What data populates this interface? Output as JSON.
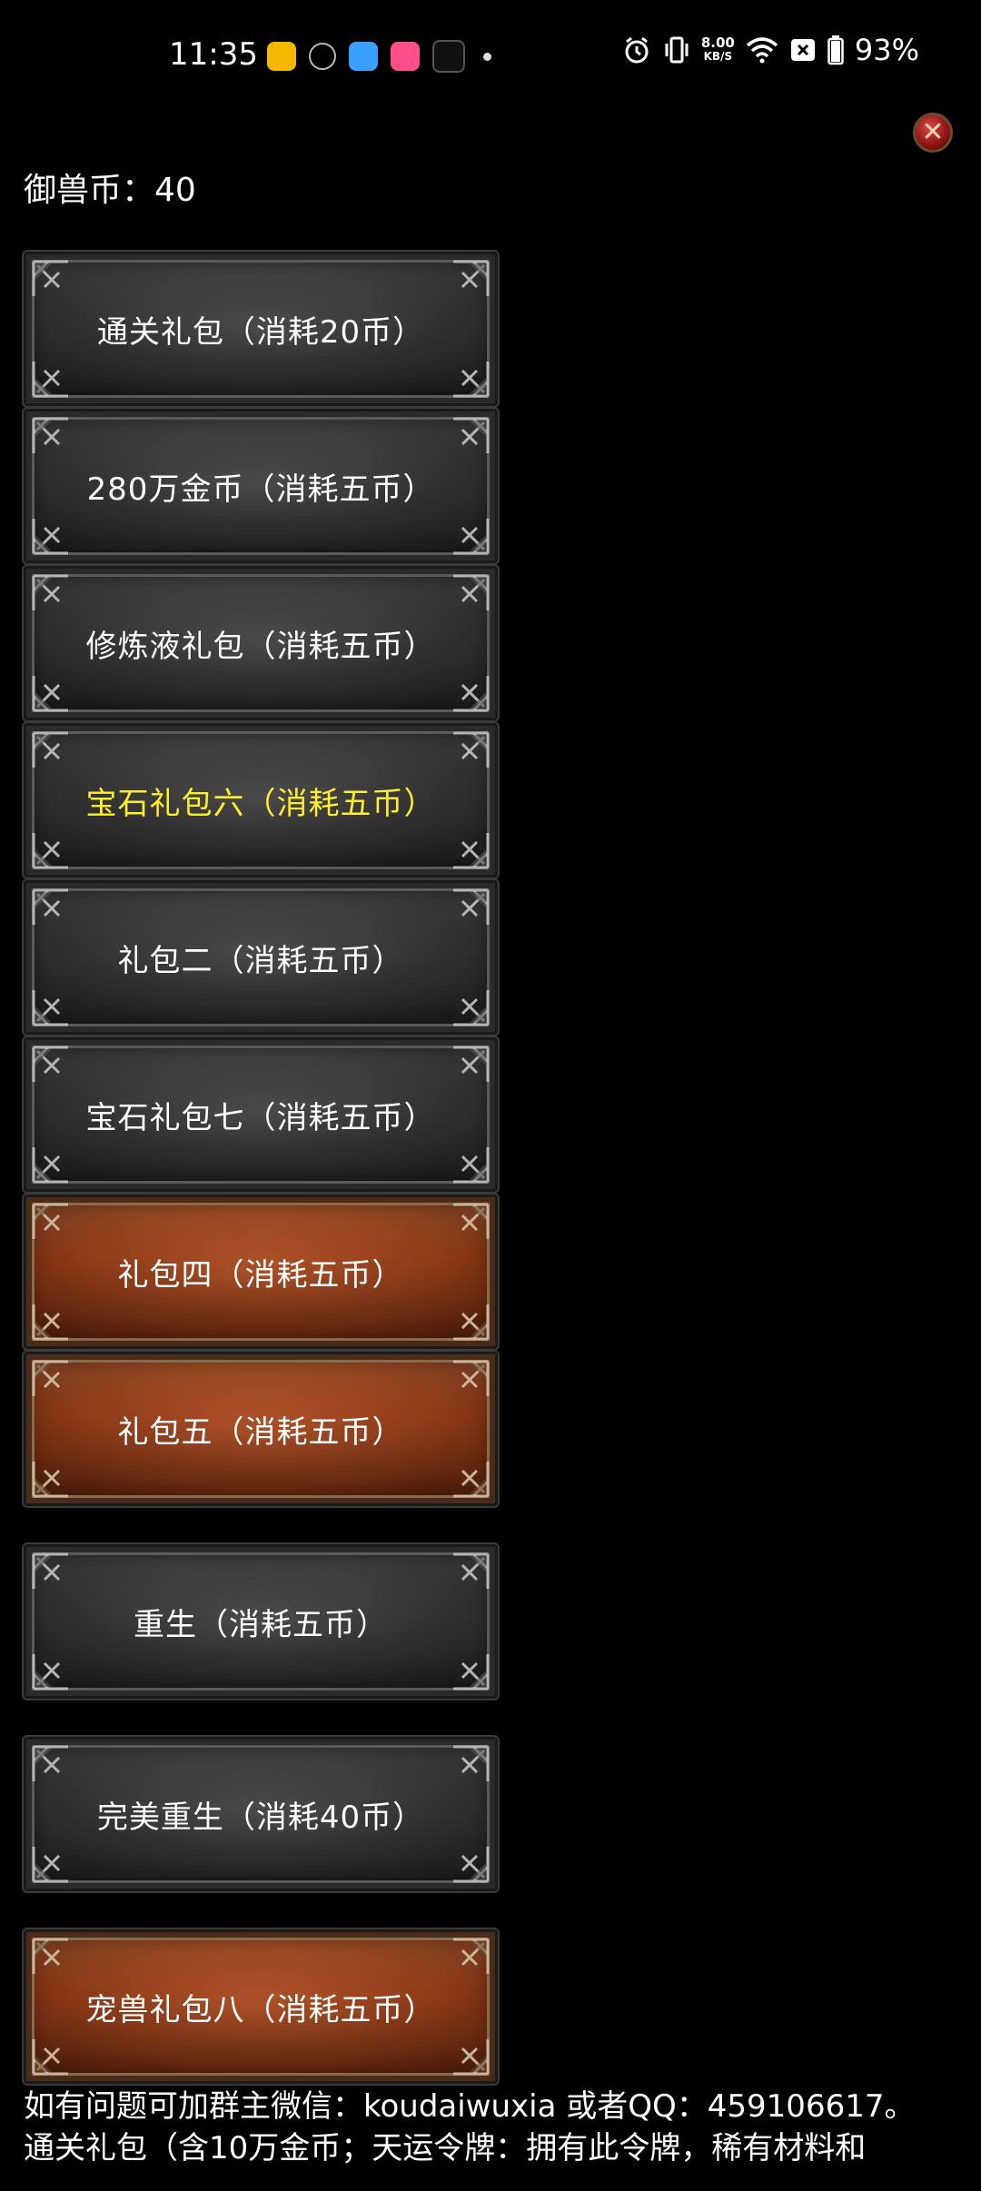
{
  "status_bar": {
    "time": "11:35",
    "net_speed_value": "8.00",
    "net_speed_unit": "KB/S",
    "battery_percent": "93%",
    "icons": [
      "alarm-icon",
      "vibrate-icon",
      "wifi-icon",
      "sim-off-icon",
      "battery-icon"
    ],
    "app_icons": [
      "app-yellow-icon",
      "app-swirl-icon",
      "app-blue-icon",
      "app-pink-icon",
      "tiktok-icon"
    ]
  },
  "header": {
    "currency_label": "御兽币：",
    "currency_value": "40"
  },
  "buttons": [
    {
      "label": "通关礼包（消耗20币）",
      "style": "gray",
      "text_color": "#ffffff"
    },
    {
      "label": "280万金币（消耗五币）",
      "style": "gray",
      "text_color": "#ffffff"
    },
    {
      "label": "修炼液礼包（消耗五币）",
      "style": "gray",
      "text_color": "#ffffff"
    },
    {
      "label": "宝石礼包六（消耗五币）",
      "style": "gray",
      "text_color": "#ffee2a"
    },
    {
      "label": "礼包二（消耗五币）",
      "style": "gray",
      "text_color": "#ffffff"
    },
    {
      "label": "宝石礼包七（消耗五币）",
      "style": "gray",
      "text_color": "#ffffff"
    },
    {
      "label": "礼包四（消耗五币）",
      "style": "orange",
      "text_color": "#ffffff"
    },
    {
      "label": "礼包五（消耗五币）",
      "style": "orange",
      "text_color": "#ffffff"
    },
    {
      "label": "重生（消耗五币）",
      "style": "gray",
      "text_color": "#ffffff"
    },
    {
      "label": "完美重生（消耗40币）",
      "style": "gray",
      "text_color": "#ffffff"
    },
    {
      "label": "宠兽礼包八（消耗五币）",
      "style": "orange",
      "text_color": "#ffffff"
    }
  ],
  "footer": {
    "line1": "如有问题可加群主微信：koudaiwuxia 或者QQ：459106617。",
    "line2": "通关礼包（含10万金币；天运令牌：拥有此令牌，稀有材料和"
  },
  "colors": {
    "background": "#000000",
    "highlight_text": "#ffee2a",
    "close_button": "#8a1410"
  }
}
